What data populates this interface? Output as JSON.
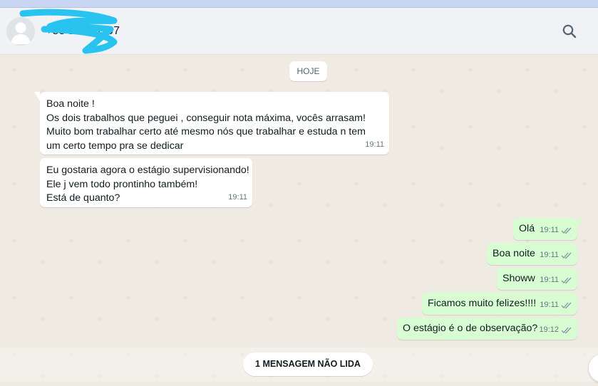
{
  "header": {
    "contact_name": "+55 11 9 6507",
    "search_icon": "search-icon",
    "avatar_icon": "default-avatar-icon"
  },
  "chat": {
    "date_chip": "HOJE",
    "incoming": [
      {
        "lines": [
          "Boa noite !",
          "Os dois trabalhos que peguei , conseguir nota máxima, vocês arrasam!",
          "Muito bom trabalhar certo até mesmo nós que trabalhar e estuda n tem",
          "um certo tempo pra se dedicar"
        ],
        "time": "19:11"
      },
      {
        "lines": [
          "Eu gostaria agora o estágio supervisionando!",
          "Ele j vem todo prontinho também!",
          "Está de quanto?"
        ],
        "time": "19:11"
      }
    ],
    "outgoing": [
      {
        "text": "Olá",
        "time": "19:11",
        "status": "double-check-icon"
      },
      {
        "text": "Boa noite",
        "time": "19:11",
        "status": "double-check-icon"
      },
      {
        "text": "Showw",
        "time": "19:11",
        "status": "double-check-icon"
      },
      {
        "text": "Ficamos muito felizes!!!!",
        "time": "19:11",
        "status": "double-check-icon"
      },
      {
        "text": "O estágio é o de observação?",
        "time": "19:12",
        "status": "double-check-icon"
      }
    ],
    "unread_label": "1 MENSAGEM NÃO LIDA"
  },
  "colors": {
    "chat_background": "#efeae2",
    "incoming_bubble": "#ffffff",
    "outgoing_bubble": "#d9fdd3",
    "header_background": "#f0f2f5",
    "redaction_mark": "#29c3f0"
  }
}
